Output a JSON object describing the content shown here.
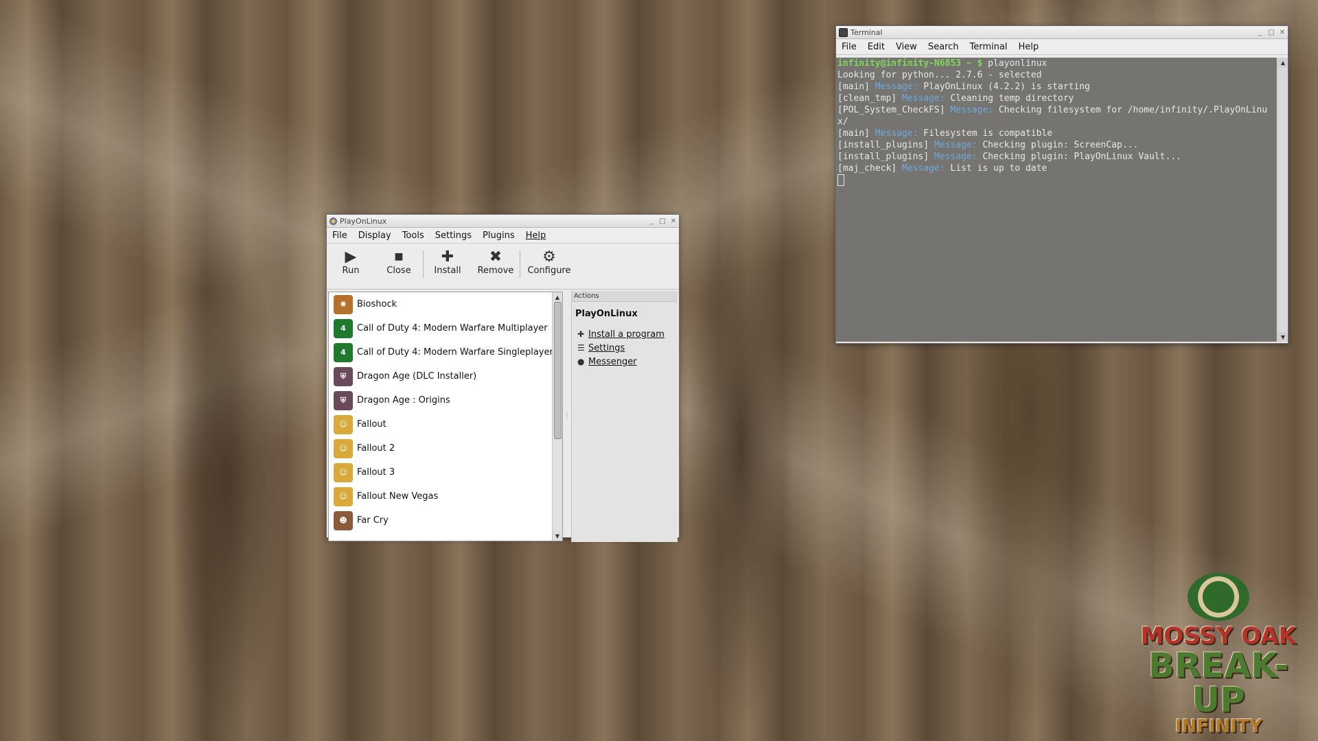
{
  "colors": {
    "accent_prompt": "#7fd85a",
    "accent_message": "#6fa8dc",
    "window_bg": "#eaeaea"
  },
  "playonlinux": {
    "title": "PlayOnLinux",
    "menu": [
      "File",
      "Display",
      "Tools",
      "Settings",
      "Plugins",
      "Help"
    ],
    "toolbar": {
      "run": "Run",
      "close": "Close",
      "install": "Install",
      "remove": "Remove",
      "configure": "Configure"
    },
    "games": [
      {
        "name": "Bioshock",
        "icon": "bioshock-icon"
      },
      {
        "name": "Call of Duty 4: Modern Warfare Multiplayer",
        "icon": "cod4-icon"
      },
      {
        "name": "Call of Duty 4: Modern Warfare Singleplayer",
        "icon": "cod4-icon"
      },
      {
        "name": "Dragon Age (DLC Installer)",
        "icon": "dragon-age-icon"
      },
      {
        "name": "Dragon Age : Origins",
        "icon": "dragon-age-icon"
      },
      {
        "name": "Fallout",
        "icon": "fallout-icon"
      },
      {
        "name": "Fallout 2",
        "icon": "fallout-icon"
      },
      {
        "name": "Fallout 3",
        "icon": "fallout-icon"
      },
      {
        "name": "Fallout New Vegas",
        "icon": "fallout-icon"
      },
      {
        "name": "Far Cry",
        "icon": "far-cry-icon"
      }
    ],
    "actions": {
      "header": "Actions",
      "title": "PlayOnLinux",
      "items": [
        "Install a program",
        "Settings",
        "Messenger"
      ]
    }
  },
  "terminal": {
    "title": "Terminal",
    "menu": [
      "File",
      "Edit",
      "View",
      "Search",
      "Terminal",
      "Help"
    ],
    "prompt": "infinity@infinity-N6853 ~ $",
    "command": " playonlinux",
    "lines": [
      {
        "plain": "Looking for python... 2.7.6 - selected"
      },
      {
        "pre": "[main] ",
        "msg": "Message:",
        "post": " PlayOnLinux (4.2.2) is starting"
      },
      {
        "pre": "[clean_tmp] ",
        "msg": "Message:",
        "post": " Cleaning temp directory"
      },
      {
        "pre": "[POL_System_CheckFS] ",
        "msg": "Message:",
        "post": " Checking filesystem for /home/infinity/.PlayOnLinu"
      },
      {
        "plain": "x/"
      },
      {
        "pre": "[main] ",
        "msg": "Message:",
        "post": " Filesystem is compatible"
      },
      {
        "pre": "[install_plugins] ",
        "msg": "Message:",
        "post": " Checking plugin: ScreenCap..."
      },
      {
        "pre": "[install_plugins] ",
        "msg": "Message:",
        "post": " Checking plugin: PlayOnLinux Vault..."
      },
      {
        "pre": "[maj_check] ",
        "msg": "Message:",
        "post": " List is up to date"
      }
    ]
  },
  "wallpaper": {
    "line1": "MOSSY OAK",
    "line2": "BREAK-UP",
    "line3": "INFINITY"
  }
}
